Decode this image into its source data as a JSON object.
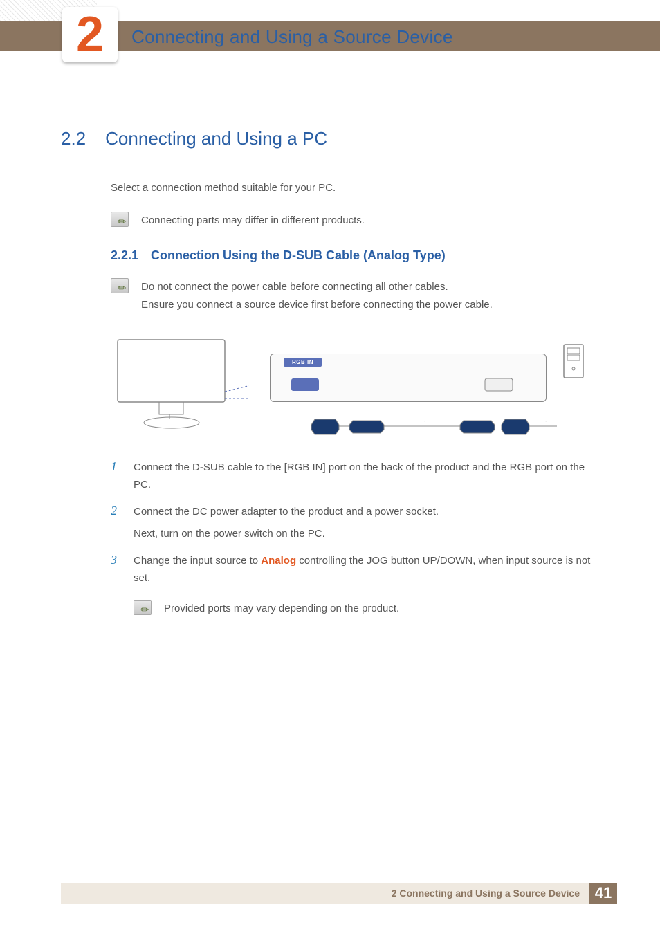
{
  "chapter": {
    "number": "2",
    "title": "Connecting and Using a Source Device"
  },
  "section": {
    "number": "2.2",
    "title": "Connecting and Using a PC"
  },
  "intro_text": "Select a connection method suitable for your PC.",
  "note1": "Connecting parts may differ in different products.",
  "subsection": {
    "number": "2.2.1",
    "title": "Connection Using the D-SUB Cable (Analog Type)"
  },
  "note2_line1": "Do not connect the power cable before connecting all other cables.",
  "note2_line2": "Ensure you connect a source device first before connecting the power cable.",
  "diagram_label": "RGB IN",
  "steps": {
    "s1": {
      "num": "1",
      "text": "Connect the D-SUB cable to the [RGB IN] port on the back of the product and the RGB port on the PC."
    },
    "s2": {
      "num": "2",
      "text": "Connect the DC power adapter to the product and a power socket.",
      "text2": "Next, turn on the power switch on the PC."
    },
    "s3": {
      "num": "3",
      "text_before": "Change the input source to ",
      "highlight": "Analog",
      "text_after": " controlling the JOG button UP/DOWN, when input source is not set."
    }
  },
  "note3": "Provided ports may vary depending on the product.",
  "footer": {
    "text": "2 Connecting and Using a Source Device",
    "page": "41"
  }
}
